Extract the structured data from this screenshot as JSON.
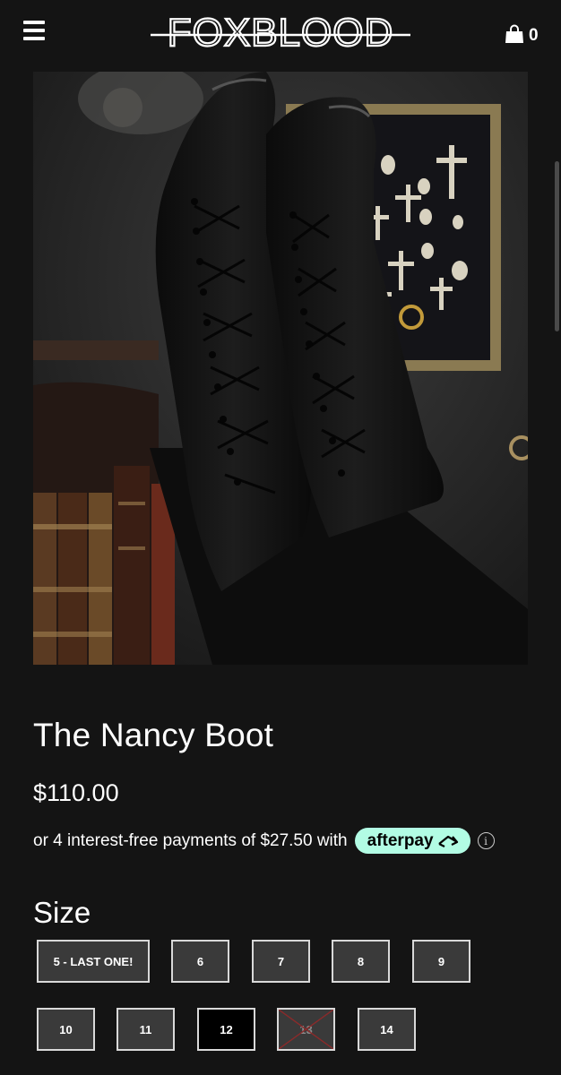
{
  "header": {
    "brand": "FOXBLOOD",
    "cart_count": "0",
    "menu_icon": "hamburger-menu-icon",
    "cart_icon": "shopping-bag-icon"
  },
  "product": {
    "title": "The Nancy Boot",
    "price": "$110.00",
    "installment_text": "or 4 interest-free payments of $27.50 with",
    "afterpay_label": "afterpay"
  },
  "size": {
    "label": "Size",
    "options": [
      {
        "label": "5 - LAST ONE!",
        "state": "available"
      },
      {
        "label": "6",
        "state": "available"
      },
      {
        "label": "7",
        "state": "available"
      },
      {
        "label": "8",
        "state": "available"
      },
      {
        "label": "9",
        "state": "available"
      },
      {
        "label": "10",
        "state": "available"
      },
      {
        "label": "11",
        "state": "available"
      },
      {
        "label": "12",
        "state": "selected"
      },
      {
        "label": "13",
        "state": "sold-out"
      },
      {
        "label": "14",
        "state": "available"
      }
    ]
  },
  "colors": {
    "background": "#141414",
    "afterpay_mint": "#b2fce4",
    "size_button_bg": "#3a3a3a",
    "sold_out_cross": "#8b2a2a"
  }
}
